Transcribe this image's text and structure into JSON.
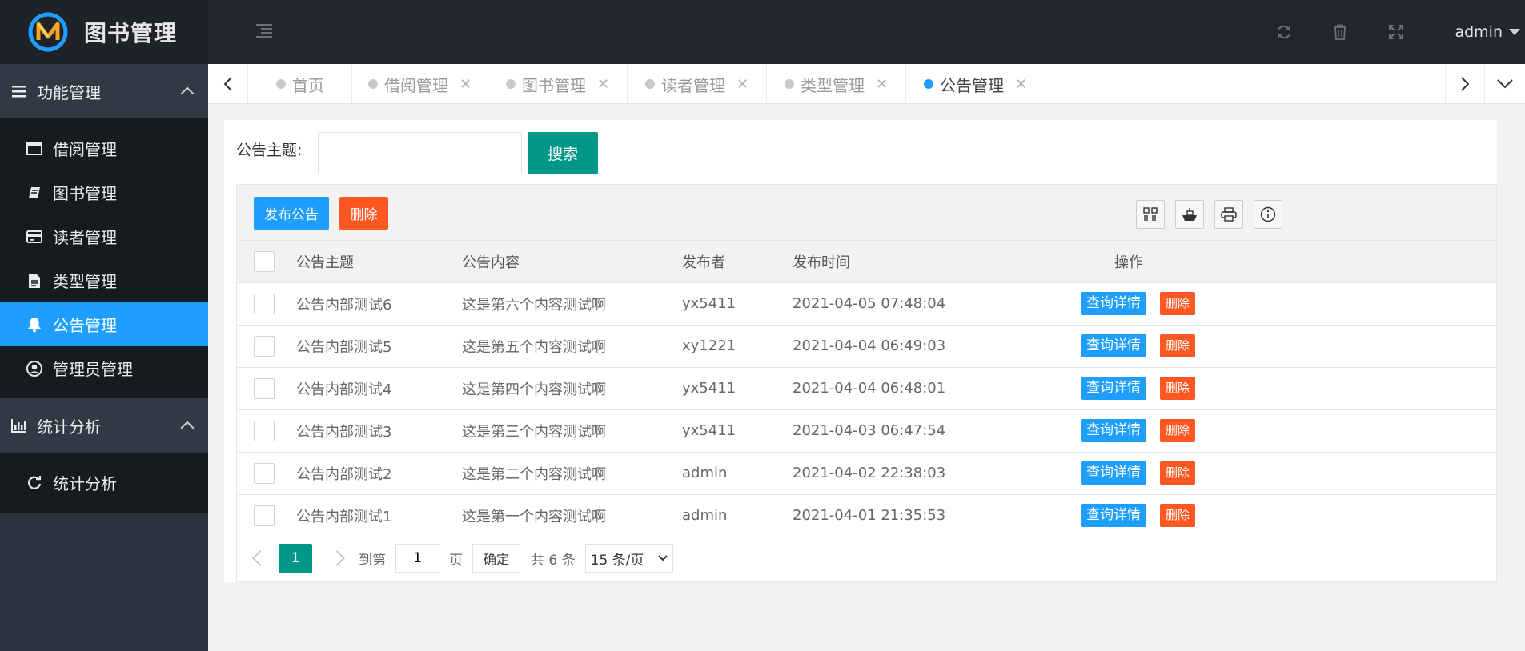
{
  "app": {
    "title": "图书管理"
  },
  "user": {
    "name": "admin"
  },
  "sidebar": {
    "groups": [
      {
        "title": "功能管理",
        "icon": "hamburger-icon",
        "items": [
          {
            "label": "借阅管理",
            "icon": "window-icon"
          },
          {
            "label": "图书管理",
            "icon": "book-icon"
          },
          {
            "label": "读者管理",
            "icon": "card-icon"
          },
          {
            "label": "类型管理",
            "icon": "file-icon"
          },
          {
            "label": "公告管理",
            "icon": "bell-icon",
            "active": true
          },
          {
            "label": "管理员管理",
            "icon": "user-circle-icon"
          }
        ]
      },
      {
        "title": "统计分析",
        "icon": "bar-chart-icon",
        "items": [
          {
            "label": "统计分析",
            "icon": "refresh-icon"
          }
        ]
      }
    ]
  },
  "tabs": [
    {
      "label": "首页",
      "closable": false
    },
    {
      "label": "借阅管理",
      "closable": true
    },
    {
      "label": "图书管理",
      "closable": true
    },
    {
      "label": "读者管理",
      "closable": true
    },
    {
      "label": "类型管理",
      "closable": true
    },
    {
      "label": "公告管理",
      "closable": true,
      "active": true
    }
  ],
  "search": {
    "label": "公告主题:",
    "value": "",
    "button": "搜索"
  },
  "toolbar": {
    "publish": "发布公告",
    "delete": "删除"
  },
  "table": {
    "columns": [
      "公告主题",
      "公告内容",
      "发布者",
      "发布时间",
      "操作"
    ],
    "rows": [
      {
        "topic": "公告内部测试6",
        "content": "这是第六个内容测试啊",
        "publisher": "yx5411",
        "time": "2021-04-05 07:48:04"
      },
      {
        "topic": "公告内部测试5",
        "content": "这是第五个内容测试啊",
        "publisher": "xy1221",
        "time": "2021-04-04 06:49:03"
      },
      {
        "topic": "公告内部测试4",
        "content": "这是第四个内容测试啊",
        "publisher": "yx5411",
        "time": "2021-04-04 06:48:01"
      },
      {
        "topic": "公告内部测试3",
        "content": "这是第三个内容测试啊",
        "publisher": "yx5411",
        "time": "2021-04-03 06:47:54"
      },
      {
        "topic": "公告内部测试2",
        "content": "这是第二个内容测试啊",
        "publisher": "admin",
        "time": "2021-04-02 22:38:03"
      },
      {
        "topic": "公告内部测试1",
        "content": "这是第一个内容测试啊",
        "publisher": "admin",
        "time": "2021-04-01 21:35:53"
      }
    ],
    "row_actions": {
      "view": "查询详情",
      "delete": "删除"
    }
  },
  "pager": {
    "current": "1",
    "goto_label": "到第",
    "goto_value": "1",
    "page_label": "页",
    "confirm": "确定",
    "total": "共 6 条",
    "page_size": "15 条/页"
  },
  "colors": {
    "sidebar_bg": "#28333e",
    "header_bg": "#23262e",
    "active_blue": "#1e9fff",
    "teal": "#009688",
    "danger": "#ff5722"
  }
}
